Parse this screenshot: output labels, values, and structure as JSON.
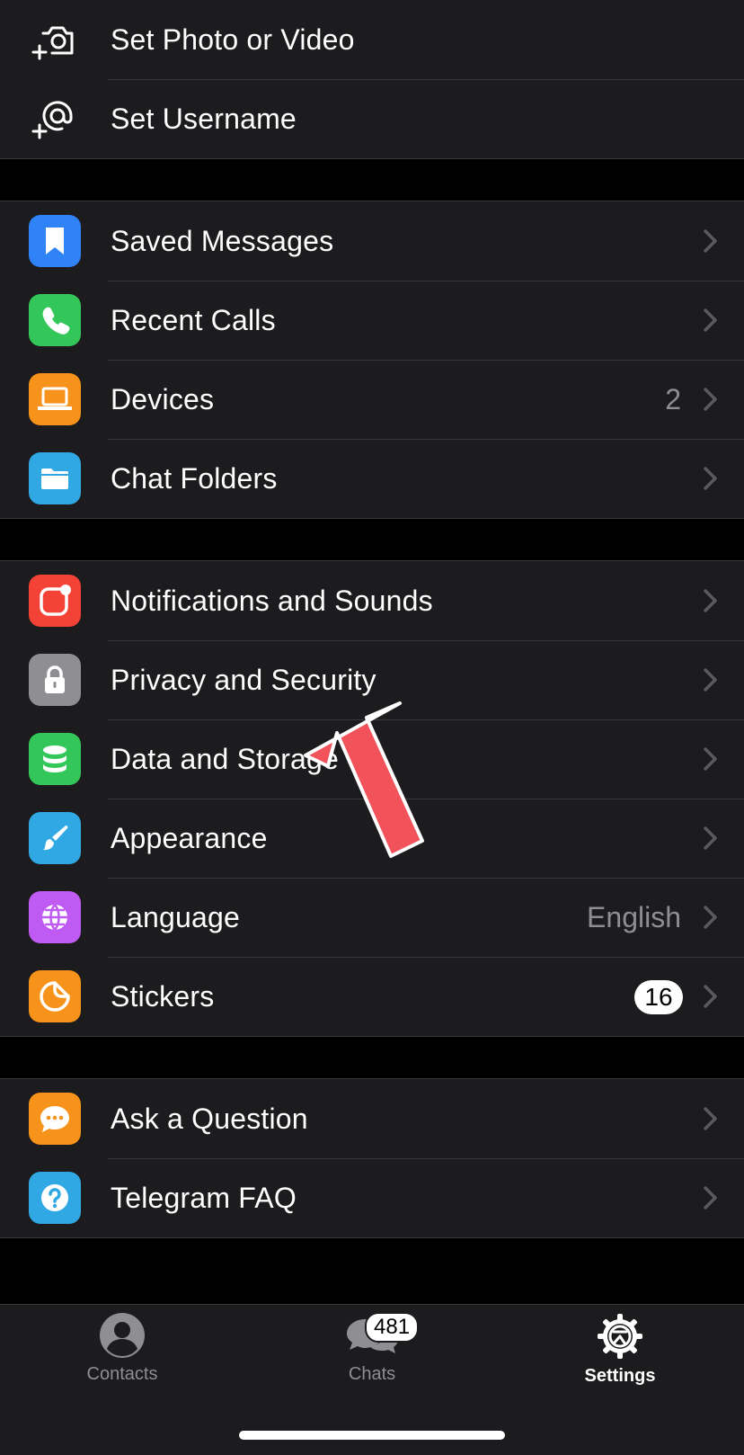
{
  "profile_group": {
    "set_photo": "Set Photo or Video",
    "set_username": "Set Username"
  },
  "group1": [
    {
      "label": "Saved Messages",
      "icon": "bookmark-icon",
      "color": "#2f83f7"
    },
    {
      "label": "Recent Calls",
      "icon": "phone-icon",
      "color": "#33c759"
    },
    {
      "label": "Devices",
      "icon": "laptop-icon",
      "color": "#f7931b",
      "value": "2"
    },
    {
      "label": "Chat Folders",
      "icon": "folder-icon",
      "color": "#2fa8e4"
    }
  ],
  "group2": [
    {
      "label": "Notifications and Sounds",
      "icon": "notification-icon",
      "color": "#f44336"
    },
    {
      "label": "Privacy and Security",
      "icon": "lock-icon",
      "color": "#8e8e93"
    },
    {
      "label": "Data and Storage",
      "icon": "database-icon",
      "color": "#33c759"
    },
    {
      "label": "Appearance",
      "icon": "brush-icon",
      "color": "#2fa8e4"
    },
    {
      "label": "Language",
      "icon": "globe-icon",
      "color": "#bf5af2",
      "value": "English"
    },
    {
      "label": "Stickers",
      "icon": "sticker-icon",
      "color": "#f7931b",
      "badge": "16"
    }
  ],
  "group3": [
    {
      "label": "Ask a Question",
      "icon": "chat-bubble-icon",
      "color": "#f7931b"
    },
    {
      "label": "Telegram FAQ",
      "icon": "question-icon",
      "color": "#2fa8e4"
    }
  ],
  "tabbar": {
    "contacts": "Contacts",
    "chats": "Chats",
    "chats_badge": "481",
    "settings": "Settings"
  },
  "colors": {
    "background": "#000000",
    "cell": "#1c1c1e",
    "separator": "#38383a",
    "annotation_arrow": "#f2525a"
  }
}
